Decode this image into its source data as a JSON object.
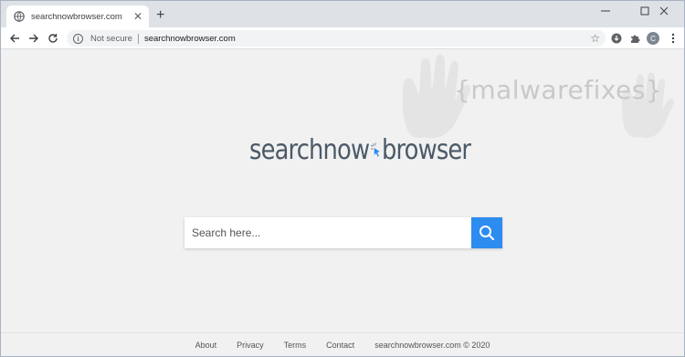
{
  "tab": {
    "title": "searchnowbrowser.com",
    "favicon": "globe-icon"
  },
  "address_bar": {
    "security_label": "Not secure",
    "url": "searchnowbrowser.com"
  },
  "watermark": {
    "text": "{malwarefixes}"
  },
  "logo": {
    "part1": "searchnow",
    "part2": "browser"
  },
  "search": {
    "placeholder": "Search here...",
    "value": ""
  },
  "footer": {
    "links": [
      "About",
      "Privacy",
      "Terms",
      "Contact"
    ],
    "copyright": "searchnowbrowser.com © 2020"
  },
  "colors": {
    "search_button": "#2d8cf0",
    "logo_text": "#4c5a68",
    "accent_arrow": "#2d8cf0",
    "page_bg": "#f1f1f1"
  },
  "toolbar_icons": [
    "back-icon",
    "forward-icon",
    "reload-icon",
    "info-icon",
    "star-icon",
    "extension-download-icon",
    "puzzle-icon",
    "profile-avatar",
    "menu-icon"
  ],
  "profile": {
    "initial": "C"
  }
}
